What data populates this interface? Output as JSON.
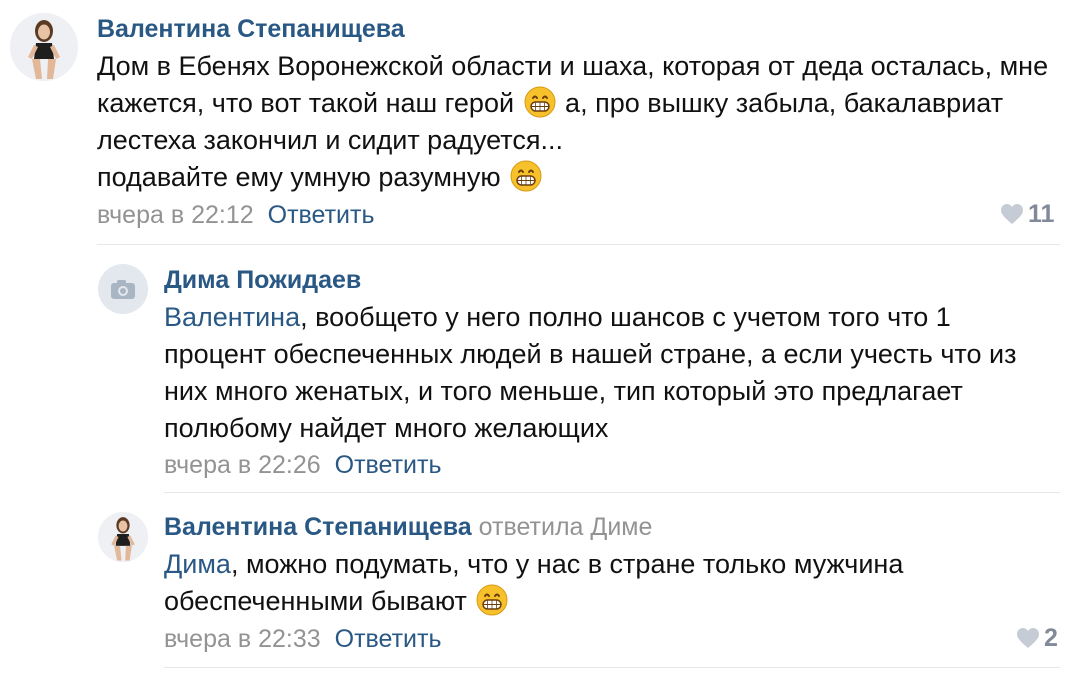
{
  "comments": [
    {
      "author": "Валентина Степанищева",
      "lines": [
        "Дом в Ебенях Воронежской области и шаха, которая от деда осталась, мне",
        [
          "кажется, что вот такой наш герой ",
          " а, про вышку забыла, бакалавриат"
        ],
        "лестеха закончил и сидит радуется...",
        [
          "подавайте ему умную разумную ",
          ""
        ]
      ],
      "time": "вчера в 22:12",
      "reply_label": "Ответить",
      "likes": "11"
    },
    {
      "author": "Дима Пожидаев",
      "mention": "Валентина",
      "lines": [
        ", вообщето у него полно шансов с учетом того что 1",
        "процент обеспеченных людей в нашей стране, а если учесть что из",
        "них много женатых, и того меньше, тип который это предлагает",
        "полюбому найдет много желающих"
      ],
      "time": "вчера в 22:26",
      "reply_label": "Ответить"
    },
    {
      "author": "Валентина Степанищева",
      "replied_to": "ответила Диме",
      "mention": "Дима",
      "lines": [
        ", можно подумать, что у нас в стране только мужчина",
        [
          "обеспеченными бывают ",
          ""
        ]
      ],
      "time": "вчера в 22:33",
      "reply_label": "Ответить",
      "likes": "2"
    }
  ],
  "icons": {
    "heart": "heart-icon",
    "camera": "camera-icon",
    "emoji": "grinning-emoji"
  },
  "colors": {
    "link": "#2a5885",
    "meta": "#939393",
    "divider": "#e7e8ec"
  }
}
